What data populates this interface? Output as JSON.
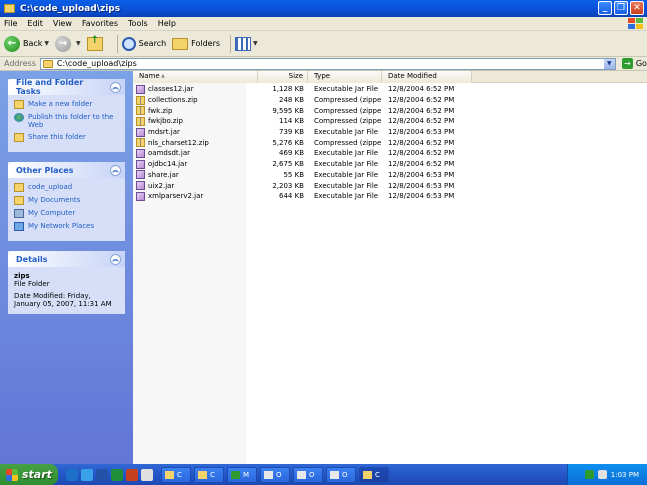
{
  "window": {
    "title": "C:\\code_upload\\zips"
  },
  "menu": [
    "File",
    "Edit",
    "View",
    "Favorites",
    "Tools",
    "Help"
  ],
  "toolbar": {
    "back": "Back",
    "search": "Search",
    "folders": "Folders"
  },
  "address": {
    "label": "Address",
    "value": "C:\\code_upload\\zips",
    "go": "Go"
  },
  "taskpane": {
    "file_folder": {
      "title": "File and Folder Tasks",
      "items": [
        "Make a new folder",
        "Publish this folder to the Web",
        "Share this folder"
      ]
    },
    "other_places": {
      "title": "Other Places",
      "items": [
        "code_upload",
        "My Documents",
        "My Computer",
        "My Network Places"
      ]
    },
    "details": {
      "title": "Details",
      "name": "zips",
      "kind": "File Folder",
      "modified": "Date Modified: Friday, January 05, 2007, 11:31 AM"
    }
  },
  "columns": {
    "name": "Name",
    "size": "Size",
    "type": "Type",
    "date": "Date Modified"
  },
  "files": [
    {
      "name": "classes12.jar",
      "size": "1,128 KB",
      "type": "Executable Jar File",
      "date": "12/8/2004 6:52 PM",
      "kind": "jar"
    },
    {
      "name": "collections.zip",
      "size": "248 KB",
      "type": "Compressed (zippe...",
      "date": "12/8/2004 6:52 PM",
      "kind": "zip"
    },
    {
      "name": "fwk.zip",
      "size": "9,595 KB",
      "type": "Compressed (zippe...",
      "date": "12/8/2004 6:52 PM",
      "kind": "zip"
    },
    {
      "name": "fwkjbo.zip",
      "size": "114 KB",
      "type": "Compressed (zippe...",
      "date": "12/8/2004 6:52 PM",
      "kind": "zip"
    },
    {
      "name": "mdsrt.jar",
      "size": "739 KB",
      "type": "Executable Jar File",
      "date": "12/8/2004 6:53 PM",
      "kind": "jar"
    },
    {
      "name": "nls_charset12.zip",
      "size": "5,276 KB",
      "type": "Compressed (zippe...",
      "date": "12/8/2004 6:52 PM",
      "kind": "zip"
    },
    {
      "name": "oamdsdt.jar",
      "size": "469 KB",
      "type": "Executable Jar File",
      "date": "12/8/2004 6:52 PM",
      "kind": "jar"
    },
    {
      "name": "ojdbc14.jar",
      "size": "2,675 KB",
      "type": "Executable Jar File",
      "date": "12/8/2004 6:52 PM",
      "kind": "jar"
    },
    {
      "name": "share.jar",
      "size": "55 KB",
      "type": "Executable Jar File",
      "date": "12/8/2004 6:53 PM",
      "kind": "jar"
    },
    {
      "name": "uix2.jar",
      "size": "2,203 KB",
      "type": "Executable Jar File",
      "date": "12/8/2004 6:53 PM",
      "kind": "jar"
    },
    {
      "name": "xmlparserv2.jar",
      "size": "644 KB",
      "type": "Executable Jar File",
      "date": "12/8/2004 6:53 PM",
      "kind": "jar"
    }
  ],
  "taskbar": {
    "start": "start",
    "tasks": [
      {
        "label": "C",
        "icon": "folder-icon"
      },
      {
        "label": "C",
        "icon": "folder-icon"
      },
      {
        "label": "M",
        "icon": "terminal-icon"
      },
      {
        "label": "O",
        "icon": "app-icon"
      },
      {
        "label": "O",
        "icon": "app-icon"
      },
      {
        "label": "O",
        "icon": "app-icon"
      },
      {
        "label": "C",
        "icon": "folder-icon"
      }
    ],
    "clock": "1:03 PM"
  },
  "colors": {
    "title_blue": "#0b4fd6",
    "taskpane_blue": "#6375d6",
    "link_blue": "#215dc6"
  }
}
